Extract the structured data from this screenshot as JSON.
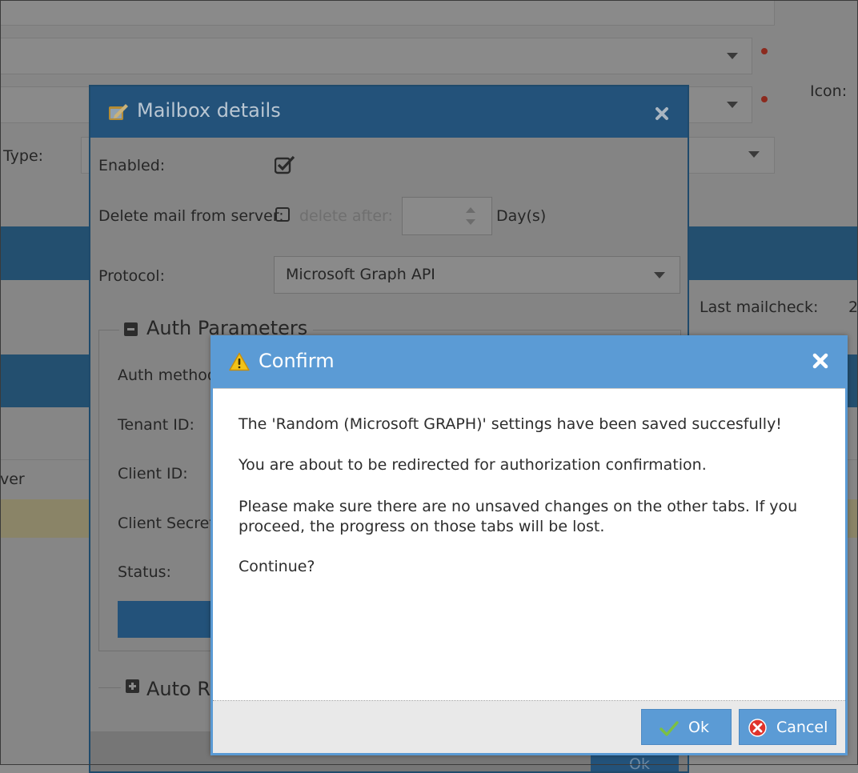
{
  "background": {
    "type_label": "Type:",
    "icon_label": "Icon:",
    "last_mailcheck_label": "Last mailcheck:",
    "last_mailcheck_value": "2",
    "column_fragment": "ver"
  },
  "mailbox_dialog": {
    "title": "Mailbox details",
    "enabled_label": "Enabled:",
    "delete_mail_label": "Delete mail from server:",
    "delete_after_label": "delete after:",
    "days_label": "Day(s)",
    "protocol_label": "Protocol:",
    "protocol_value": "Microsoft Graph API",
    "auth_section_title": "Auth Parameters",
    "auth_method_label": "Auth method",
    "tenant_id_label": "Tenant ID:",
    "client_id_label": "Client ID:",
    "client_secret_label": "Client Secret:",
    "status_label": "Status:",
    "auto_section_title": "Auto R",
    "ok_fragment": "Ok"
  },
  "confirm_dialog": {
    "title": "Confirm",
    "message_1": "The 'Random (Microsoft GRAPH)' settings have been saved succesfully!",
    "message_2": "You are about to be redirected for authorization confirmation.",
    "message_3": "Please make sure there are no unsaved changes on the other tabs. If you proceed, the progress on those tabs will be lost.",
    "message_4": "Continue?",
    "ok_label": "Ok",
    "cancel_label": "Cancel"
  },
  "colors": {
    "dialog_header": "#5b9bd5",
    "button": "#5b9bd5",
    "warning": "#f2c318",
    "cancel_icon": "#e0332b",
    "ok_icon": "#7cc043"
  }
}
